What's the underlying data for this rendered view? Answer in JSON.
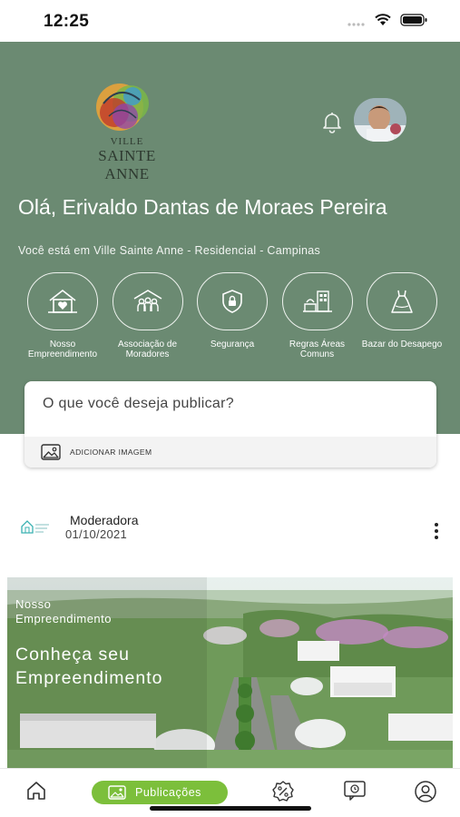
{
  "status_bar": {
    "time": "12:25"
  },
  "header": {
    "logo": {
      "line1": "VILLE",
      "line2": "SAINTE ANNE"
    },
    "greeting": "Olá, Erivaldo Dantas de Moraes Pereira",
    "location": "Você está em Ville Sainte Anne - Residencial - Campinas"
  },
  "shortcuts": [
    {
      "label": "Nosso Empreendimento",
      "icon": "house-heart-icon"
    },
    {
      "label": "Associação de Moradores",
      "icon": "people-group-icon"
    },
    {
      "label": "Segurança",
      "icon": "shield-lock-icon"
    },
    {
      "label": "Regras Áreas Comuns",
      "icon": "building-rules-icon"
    },
    {
      "label": "Bazar do Desapego",
      "icon": "dress-icon"
    }
  ],
  "publish": {
    "prompt": "O que você deseja publicar?",
    "add_image": "ADICIONAR IMAGEM"
  },
  "post": {
    "author": "Moderadora",
    "date": "01/10/2021",
    "overline": "Nosso Empreendimento",
    "title": "Conheça seu Empreendimento"
  },
  "tabbar": {
    "active_label": "Publicações",
    "tabs": [
      "home-icon",
      "image-icon",
      "discount-icon",
      "chat-icon",
      "profile-icon"
    ],
    "accent": "#7cbf3b"
  },
  "colors": {
    "header_bg": "#6b8a72",
    "accent": "#7cbf3b"
  }
}
